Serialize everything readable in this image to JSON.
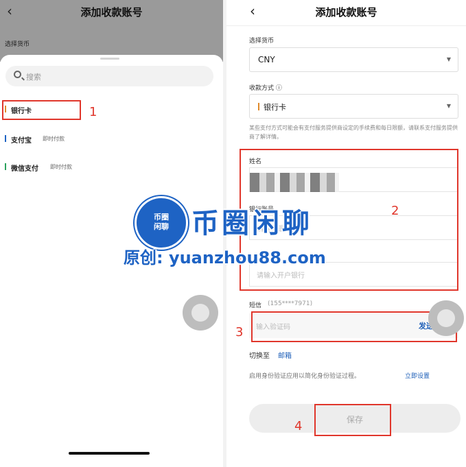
{
  "left": {
    "back_icon": "chevron-left-icon",
    "title": "添加收款账号",
    "currency_label": "选择货币",
    "search_placeholder": "搜索",
    "options": [
      {
        "label": "银行卡",
        "tag": "",
        "color": "#e08a2b"
      },
      {
        "label": "支付宝",
        "tag": "即时付款",
        "color": "#1e63c4"
      },
      {
        "label": "微信支付",
        "tag": "即时付款",
        "color": "#2aa25c"
      }
    ],
    "annotation": "1"
  },
  "right": {
    "back_icon": "chevron-left-icon",
    "title": "添加收款账号",
    "currency_label": "选择货币",
    "currency_value": "CNY",
    "method_label": "收款方式 ⓘ",
    "method_value": "银行卡",
    "help_text": "某些支付方式可能会有支付服务提供商设定的手续费和每日限额，请联系支付服务提供商了解详情。",
    "name_label": "姓名",
    "account_label": "银行账号",
    "account_placeholder": "请输入银行账号",
    "bank_placeholder": "请输入开户银行",
    "sms_label": "短信",
    "sms_phone": "(155****7971)",
    "code_placeholder": "输入验证码",
    "send_code": "发送验证码",
    "switch_label": "切换至",
    "switch_link": "邮箱",
    "bio_text": "启用身份验证应用以简化身份验证过程。",
    "bio_link": "立即设置",
    "save_label": "保存",
    "annotations": [
      "2",
      "3",
      "4"
    ]
  },
  "watermark": {
    "circle_text_1": "币圈",
    "circle_text_2": "闲聊",
    "brand": "币圈闲聊",
    "line": "原创: yuanzhou88.com"
  },
  "colors": {
    "accent": "#1e63c4",
    "annotation": "#e0362b",
    "link": "#1e5fb8"
  }
}
